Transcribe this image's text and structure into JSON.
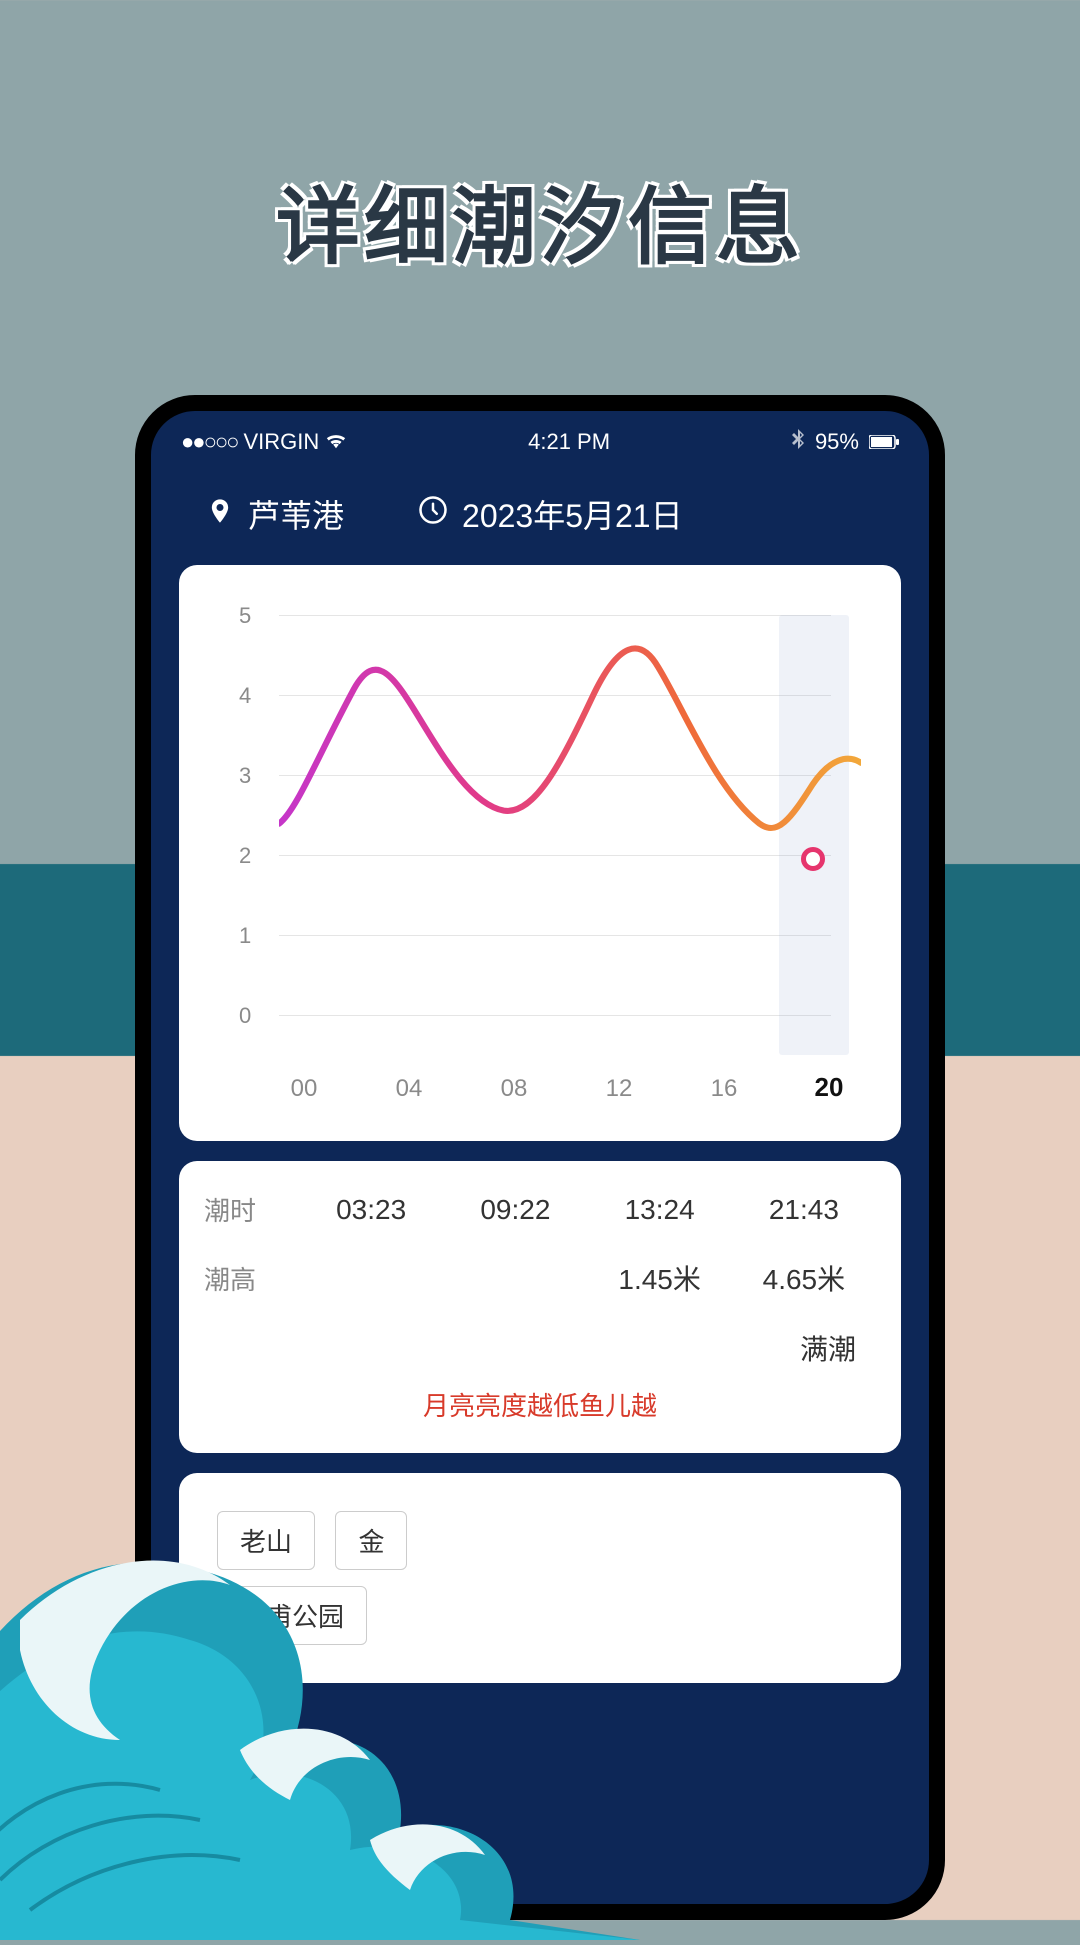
{
  "promo_title": "详细潮汐信息",
  "status": {
    "carrier": "VIRGIN",
    "time": "4:21 PM",
    "battery": "95%"
  },
  "header": {
    "location": "芦苇港",
    "date": "2023年5月21日"
  },
  "chart_data": {
    "type": "line",
    "title": "",
    "xlabel": "",
    "ylabel": "",
    "ylim": [
      0,
      5
    ],
    "y_ticks": [
      "0",
      "1",
      "2",
      "3",
      "4",
      "5"
    ],
    "x_ticks": [
      "00",
      "04",
      "08",
      "12",
      "16",
      "20"
    ],
    "highlighted_x": "20",
    "x": [
      0,
      1,
      2,
      3,
      4,
      5,
      6,
      7,
      8,
      9,
      10,
      11,
      12,
      13,
      14,
      15,
      16,
      17,
      18,
      19,
      20,
      21,
      22,
      23
    ],
    "values": [
      2.0,
      2.3,
      3.2,
      3.95,
      3.8,
      3.2,
      2.7,
      2.3,
      2.2,
      2.3,
      2.7,
      3.3,
      4.1,
      4.55,
      4.6,
      4.3,
      3.6,
      2.9,
      2.3,
      2.0,
      2.0,
      2.3,
      2.7,
      2.85
    ],
    "current_marker": {
      "x": 20,
      "y": 2.0
    }
  },
  "tide_table": {
    "rows": [
      {
        "label": "潮时",
        "cells": [
          "03:23",
          "09:22",
          "13:24",
          "21:43"
        ]
      },
      {
        "label": "潮高",
        "cells": [
          "",
          "",
          "1.45米",
          "4.65米"
        ]
      }
    ],
    "status_tag": "满潮",
    "tip": "月亮亮度越低鱼儿越"
  },
  "chips": [
    "老山",
    "金",
    "皇甫公园"
  ]
}
